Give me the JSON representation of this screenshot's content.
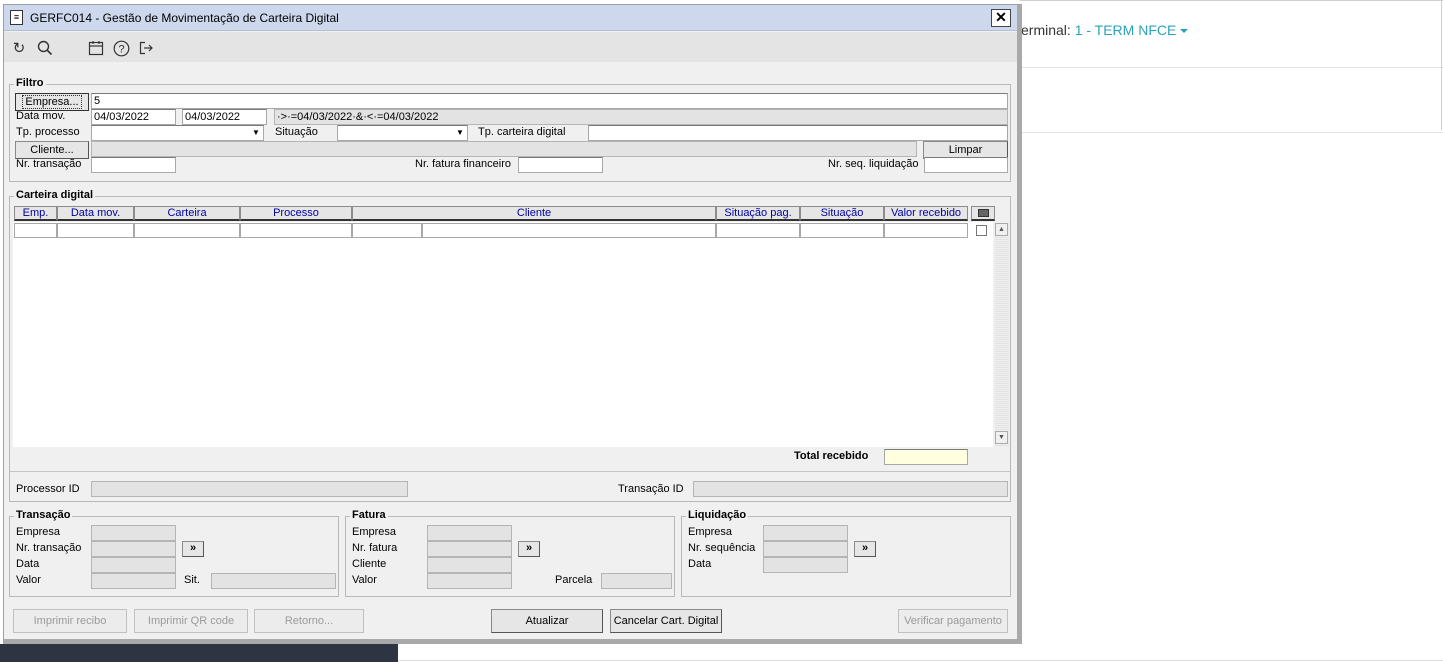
{
  "background": {
    "terminal_label": "erminal: ",
    "terminal_value": "1 - TERM NFCE"
  },
  "window": {
    "title": "GERFC014 - Gestão de Movimentação de Carteira Digital",
    "close": "✕"
  },
  "toolbar": {
    "refresh_icon": "↻",
    "search_icon": "⚲",
    "calendar_icon": "▦",
    "help_icon": "?",
    "exit_icon": "⇥"
  },
  "filtro": {
    "title": "Filtro",
    "empresa_button": "Empresa...",
    "empresa_value": "5",
    "data_mov_label": "Data mov.",
    "data_mov_from": "04/03/2022",
    "data_mov_to": "04/03/2022",
    "data_mov_expr": "·>·=04/03/2022·&·<·=04/03/2022",
    "tp_processo_label": "Tp. processo",
    "tp_processo_value": "",
    "situacao_label": "Situação",
    "situacao_value": "",
    "tp_carteira_label": "Tp. carteira digital",
    "tp_carteira_value": "",
    "cliente_button": "Cliente...",
    "cliente_value": "",
    "limpar_button": "Limpar",
    "nr_transacao_label": "Nr. transação",
    "nr_transacao_value": "",
    "nr_fatura_label": "Nr. fatura financeiro",
    "nr_fatura_value": "",
    "nr_seq_label": "Nr. seq. liquidação",
    "nr_seq_value": ""
  },
  "carteira": {
    "title": "Carteira digital",
    "columns": [
      "Emp.",
      "Data mov.",
      "Carteira",
      "Processo",
      "Cliente",
      "Situação pag.",
      "Situação",
      "Valor recebido"
    ],
    "total_label": "Total recebido",
    "total_value": ""
  },
  "ids": {
    "processor_label": "Processor ID",
    "processor_value": "",
    "transacao_label": "Transação ID",
    "transacao_value": ""
  },
  "transacao": {
    "title": "Transação",
    "empresa_label": "Empresa",
    "nr_label": "Nr. transação",
    "data_label": "Data",
    "valor_label": "Valor",
    "sit_label": "Sit.",
    "go": "»"
  },
  "fatura": {
    "title": "Fatura",
    "empresa_label": "Empresa",
    "nr_label": "Nr. fatura",
    "cliente_label": "Cliente",
    "valor_label": "Valor",
    "parcela_label": "Parcela",
    "go": "»"
  },
  "liquidacao": {
    "title": "Liquidação",
    "empresa_label": "Empresa",
    "nr_label": "Nr. sequência",
    "data_label": "Data",
    "go": "»"
  },
  "actions": {
    "imprimir_recibo": "Imprimir recibo",
    "imprimir_qr": "Imprimir QR code",
    "retorno": "Retorno...",
    "atualizar": "Atualizar",
    "cancelar": "Cancelar Cart. Digital",
    "verificar": "Verificar pagamento"
  }
}
